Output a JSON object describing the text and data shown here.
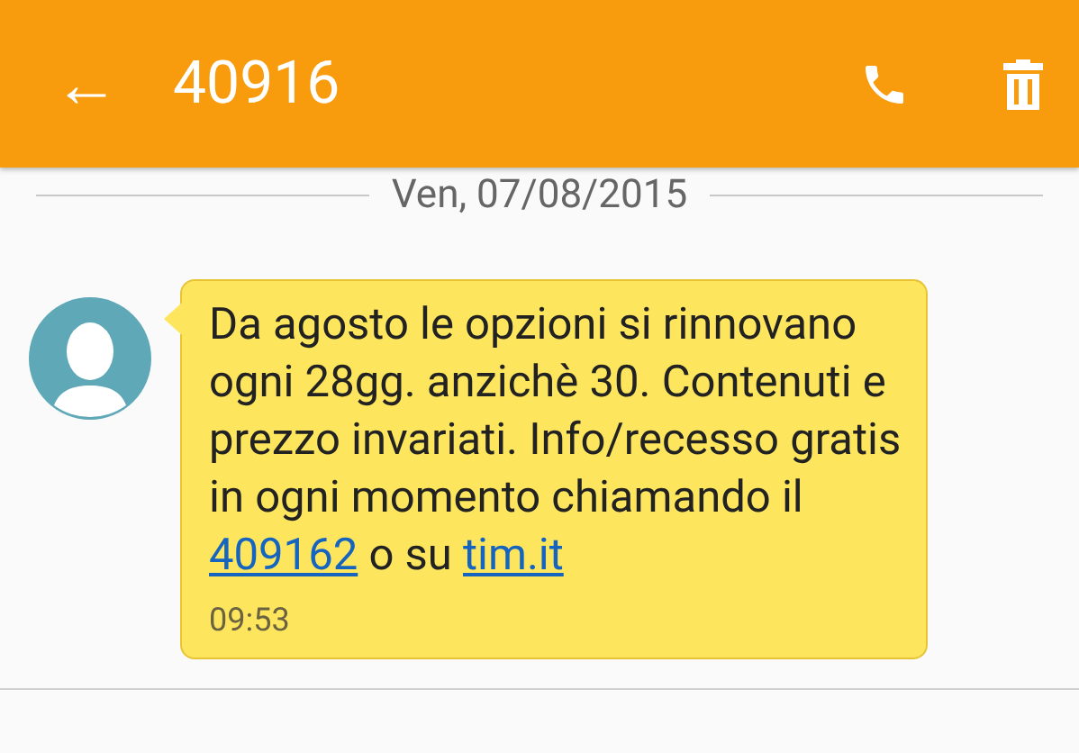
{
  "app_bar": {
    "back_icon": "←",
    "title": "40916"
  },
  "date_separator": "Ven, 07/08/2015",
  "messages": [
    {
      "kind": "incoming",
      "time": "09:53",
      "parts": [
        {
          "kind": "text",
          "text": "Da agosto le opzioni si rinnovano ogni 28gg. anzichè 30. Contenuti e prezzo invariati. Info/recesso gratis in ogni momento chiamando il "
        },
        {
          "kind": "link",
          "text": "409162"
        },
        {
          "kind": "text",
          "text": " o su "
        },
        {
          "kind": "link",
          "text": "tim.it"
        }
      ]
    }
  ]
}
